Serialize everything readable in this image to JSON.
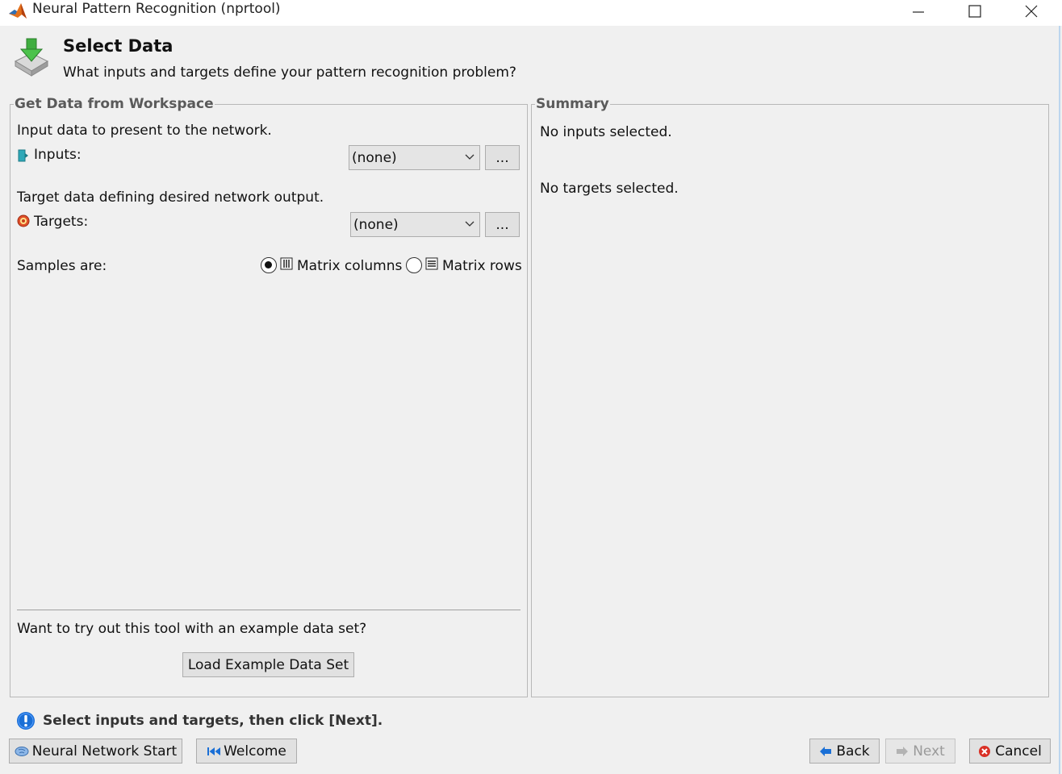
{
  "window": {
    "title": "Neural Pattern Recognition (nprtool)"
  },
  "header": {
    "title": "Select Data",
    "subtitle": "What inputs and targets define your pattern recognition problem?"
  },
  "workspace_panel": {
    "legend": "Get Data from Workspace",
    "inputs_desc": "Input data to present to the network.",
    "inputs_label": "Inputs:",
    "inputs_value": "(none)",
    "inputs_browse": "...",
    "targets_desc": "Target data defining desired network output.",
    "targets_label": "Targets:",
    "targets_value": "(none)",
    "targets_browse": "...",
    "samples_label": "Samples are:",
    "samples_options": [
      "Matrix columns",
      "Matrix rows"
    ],
    "samples_selected": "Matrix columns",
    "example_prompt": "Want to try out this tool with an example data set?",
    "load_example": "Load Example Data Set"
  },
  "summary_panel": {
    "legend": "Summary",
    "inputs_status": "No inputs selected.",
    "targets_status": "No targets selected."
  },
  "status": {
    "message": "Select inputs and targets, then click [Next]."
  },
  "footer": {
    "nn_start": "Neural Network Start",
    "welcome": "Welcome",
    "back": "Back",
    "next": "Next",
    "cancel": "Cancel"
  },
  "colors": {
    "accent_blue": "#1a6fd6",
    "cancel_red": "#d93025",
    "disabled_text": "#9a9a9a"
  }
}
